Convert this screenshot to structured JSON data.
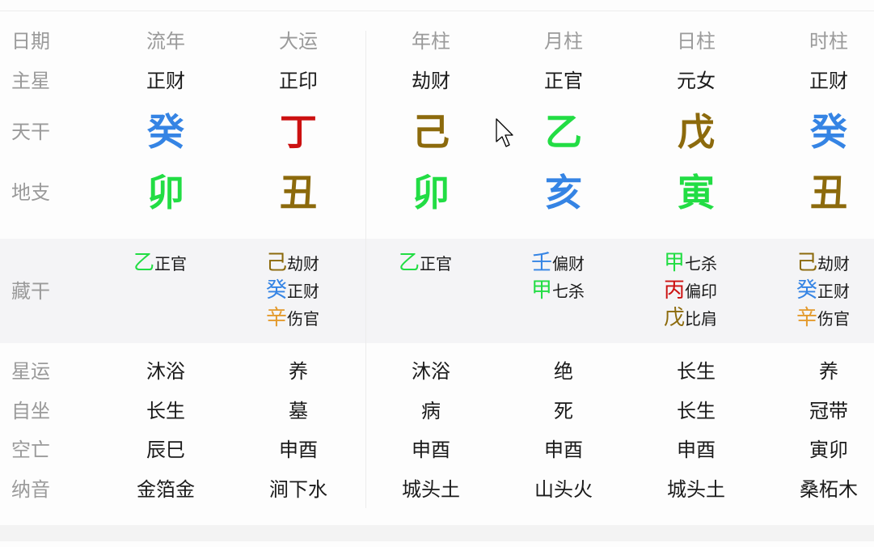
{
  "colors": {
    "wood": "#22dd44",
    "fire": "#cc1111",
    "earth": "#8c6a0c",
    "metal": "#e39a2d",
    "water": "#3584e4",
    "label": "#9a9a9a",
    "text": "#1a1a1a"
  },
  "row_labels": {
    "date": "日期",
    "main_star": "主星",
    "heavenly_stem": "天干",
    "earthly_branch": "地支",
    "hidden_stems": "藏干",
    "star_fortune": "星运",
    "self_seat": "自坐",
    "void": "空亡",
    "nayin": "纳音"
  },
  "columns": [
    {
      "header": "流年",
      "main_star": "正财",
      "stem": {
        "char": "癸",
        "color": "#3584e4"
      },
      "branch": {
        "char": "卯",
        "color": "#22dd44"
      },
      "hidden": [
        {
          "stem": "乙",
          "color": "#22dd44",
          "god": "正官"
        }
      ],
      "star_fortune": "沐浴",
      "self_seat": "长生",
      "void": "辰巳",
      "nayin": "金箔金"
    },
    {
      "header": "大运",
      "main_star": "正印",
      "stem": {
        "char": "丁",
        "color": "#cc1111"
      },
      "branch": {
        "char": "丑",
        "color": "#8c6a0c"
      },
      "hidden": [
        {
          "stem": "己",
          "color": "#8c6a0c",
          "god": "劫财"
        },
        {
          "stem": "癸",
          "color": "#3584e4",
          "god": "正财"
        },
        {
          "stem": "辛",
          "color": "#e39a2d",
          "god": "伤官"
        }
      ],
      "star_fortune": "养",
      "self_seat": "墓",
      "void": "申酉",
      "nayin": "涧下水"
    },
    {
      "header": "年柱",
      "main_star": "劫财",
      "stem": {
        "char": "己",
        "color": "#8c6a0c"
      },
      "branch": {
        "char": "卯",
        "color": "#22dd44"
      },
      "hidden": [
        {
          "stem": "乙",
          "color": "#22dd44",
          "god": "正官"
        }
      ],
      "star_fortune": "沐浴",
      "self_seat": "病",
      "void": "申酉",
      "nayin": "城头土"
    },
    {
      "header": "月柱",
      "main_star": "正官",
      "stem": {
        "char": "乙",
        "color": "#22dd44"
      },
      "branch": {
        "char": "亥",
        "color": "#3584e4"
      },
      "hidden": [
        {
          "stem": "壬",
          "color": "#3584e4",
          "god": "偏财"
        },
        {
          "stem": "甲",
          "color": "#22dd44",
          "god": "七杀"
        }
      ],
      "star_fortune": "绝",
      "self_seat": "死",
      "void": "申酉",
      "nayin": "山头火"
    },
    {
      "header": "日柱",
      "main_star": "元女",
      "stem": {
        "char": "戊",
        "color": "#8c6a0c"
      },
      "branch": {
        "char": "寅",
        "color": "#22dd44"
      },
      "hidden": [
        {
          "stem": "甲",
          "color": "#22dd44",
          "god": "七杀"
        },
        {
          "stem": "丙",
          "color": "#cc1111",
          "god": "偏印"
        },
        {
          "stem": "戊",
          "color": "#8c6a0c",
          "god": "比肩"
        }
      ],
      "star_fortune": "长生",
      "self_seat": "长生",
      "void": "申酉",
      "nayin": "城头土"
    },
    {
      "header": "时柱",
      "main_star": "正财",
      "stem": {
        "char": "癸",
        "color": "#3584e4"
      },
      "branch": {
        "char": "丑",
        "color": "#8c6a0c"
      },
      "hidden": [
        {
          "stem": "己",
          "color": "#8c6a0c",
          "god": "劫财"
        },
        {
          "stem": "癸",
          "color": "#3584e4",
          "god": "正财"
        },
        {
          "stem": "辛",
          "color": "#e39a2d",
          "god": "伤官"
        }
      ],
      "star_fortune": "养",
      "self_seat": "冠带",
      "void": "寅卯",
      "nayin": "桑柘木"
    }
  ]
}
